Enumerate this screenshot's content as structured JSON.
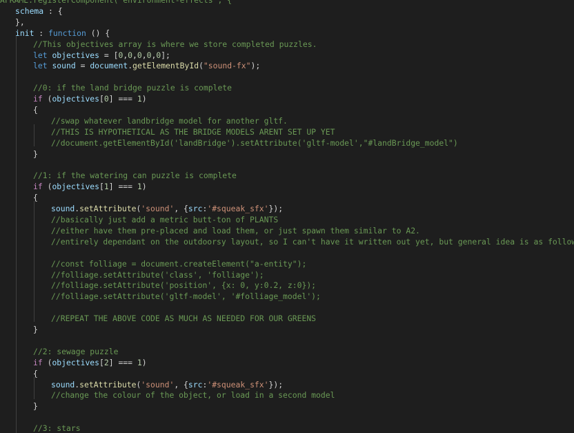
{
  "editor": {
    "language": "javascript",
    "theme_colors": {
      "background": "#1e1e1e",
      "default": "#d4d4d4",
      "keyword": "#569cd6",
      "control": "#c586c0",
      "function": "#dcdcaa",
      "variable": "#9cdcfe",
      "string": "#ce9178",
      "number": "#b5cea8",
      "comment": "#6a9955"
    },
    "lines": [
      {
        "tokens": [
          [
            "cmt",
            "AFRAME.registerComponent('environment-effects', {"
          ]
        ]
      },
      {
        "tokens": [
          [
            "var",
            "schema"
          ],
          [
            "pun",
            " : {"
          ]
        ]
      },
      {
        "tokens": [
          [
            "pun",
            "},"
          ]
        ]
      },
      {
        "tokens": [
          [
            "var",
            "init"
          ],
          [
            "pun",
            " : "
          ],
          [
            "kw",
            "function"
          ],
          [
            "pun",
            " () {"
          ]
        ]
      },
      {
        "tokens": [
          [
            "cmt",
            "//This objectives array is where we store completed puzzles."
          ]
        ]
      },
      {
        "tokens": [
          [
            "kw",
            "let"
          ],
          [
            "pun",
            " "
          ],
          [
            "var",
            "objectives"
          ],
          [
            "pun",
            " = ["
          ],
          [
            "num",
            "0"
          ],
          [
            "pun",
            ","
          ],
          [
            "num",
            "0"
          ],
          [
            "pun",
            ","
          ],
          [
            "num",
            "0"
          ],
          [
            "pun",
            ","
          ],
          [
            "num",
            "0"
          ],
          [
            "pun",
            ","
          ],
          [
            "num",
            "0"
          ],
          [
            "pun",
            "];"
          ]
        ]
      },
      {
        "tokens": [
          [
            "kw",
            "let"
          ],
          [
            "pun",
            " "
          ],
          [
            "var",
            "sound"
          ],
          [
            "pun",
            " = "
          ],
          [
            "var",
            "document"
          ],
          [
            "pun",
            "."
          ],
          [
            "fn",
            "getElementById"
          ],
          [
            "pun",
            "("
          ],
          [
            "str",
            "\"sound-fx\""
          ],
          [
            "pun",
            ");"
          ]
        ]
      },
      {
        "tokens": []
      },
      {
        "tokens": [
          [
            "cmt",
            "//0: if the land bridge puzzle is complete"
          ]
        ]
      },
      {
        "tokens": [
          [
            "ctl",
            "if"
          ],
          [
            "pun",
            " ("
          ],
          [
            "var",
            "objectives"
          ],
          [
            "pun",
            "["
          ],
          [
            "num",
            "0"
          ],
          [
            "pun",
            "] === "
          ],
          [
            "num",
            "1"
          ],
          [
            "pun",
            ")"
          ]
        ]
      },
      {
        "tokens": [
          [
            "pun",
            "{"
          ]
        ]
      },
      {
        "tokens": [
          [
            "cmt",
            "//swap whatever landbridge model for another gltf."
          ]
        ]
      },
      {
        "tokens": [
          [
            "cmt",
            "//THIS IS HYPOTHETICAL AS THE BRIDGE MODELS ARENT SET UP YET"
          ]
        ]
      },
      {
        "tokens": [
          [
            "cmt",
            "//document.getElementById('landBridge').setAttribute('gltf-model',\"#landBridge_model\")"
          ]
        ]
      },
      {
        "tokens": [
          [
            "pun",
            "}"
          ]
        ]
      },
      {
        "tokens": []
      },
      {
        "tokens": [
          [
            "cmt",
            "//1: if the watering can puzzle is complete"
          ]
        ]
      },
      {
        "tokens": [
          [
            "ctl",
            "if"
          ],
          [
            "pun",
            " ("
          ],
          [
            "var",
            "objectives"
          ],
          [
            "pun",
            "["
          ],
          [
            "num",
            "1"
          ],
          [
            "pun",
            "] === "
          ],
          [
            "num",
            "1"
          ],
          [
            "pun",
            ")"
          ]
        ]
      },
      {
        "tokens": [
          [
            "pun",
            "{"
          ]
        ]
      },
      {
        "tokens": [
          [
            "var",
            "sound"
          ],
          [
            "pun",
            "."
          ],
          [
            "fn",
            "setAttribute"
          ],
          [
            "pun",
            "("
          ],
          [
            "str",
            "'sound'"
          ],
          [
            "pun",
            ", {"
          ],
          [
            "var",
            "src"
          ],
          [
            "pun",
            ":"
          ],
          [
            "str",
            "'#squeak_sfx'"
          ],
          [
            "pun",
            "});"
          ]
        ]
      },
      {
        "tokens": [
          [
            "cmt",
            "//basically just add a metric butt-ton of PLANTS"
          ]
        ]
      },
      {
        "tokens": [
          [
            "cmt",
            "//either have them pre-placed and load them, or just spawn them similar to A2."
          ]
        ]
      },
      {
        "tokens": [
          [
            "cmt",
            "//entirely dependant on the outdoorsy layout, so I can't have it written out yet, but general idea is as follows:"
          ]
        ]
      },
      {
        "tokens": []
      },
      {
        "tokens": [
          [
            "cmt",
            "//const folliage = document.createElement(\"a-entity\");"
          ]
        ]
      },
      {
        "tokens": [
          [
            "cmt",
            "//folliage.setAttribute('class', 'folliage');"
          ]
        ]
      },
      {
        "tokens": [
          [
            "cmt",
            "//folliage.setAttribute('position', {x: 0, y:0.2, z:0});"
          ]
        ]
      },
      {
        "tokens": [
          [
            "cmt",
            "//folliage.setAttribute('gltf-model', '#folliage_model');"
          ]
        ]
      },
      {
        "tokens": []
      },
      {
        "tokens": [
          [
            "cmt",
            "//REPEAT THE ABOVE CODE AS MUCH AS NEEDED FOR OUR GREENS"
          ]
        ]
      },
      {
        "tokens": [
          [
            "pun",
            "}"
          ]
        ]
      },
      {
        "tokens": []
      },
      {
        "tokens": [
          [
            "cmt",
            "//2: sewage puzzle"
          ]
        ]
      },
      {
        "tokens": [
          [
            "ctl",
            "if"
          ],
          [
            "pun",
            " ("
          ],
          [
            "var",
            "objectives"
          ],
          [
            "pun",
            "["
          ],
          [
            "num",
            "2"
          ],
          [
            "pun",
            "] === "
          ],
          [
            "num",
            "1"
          ],
          [
            "pun",
            ")"
          ]
        ]
      },
      {
        "tokens": [
          [
            "pun",
            "{"
          ]
        ]
      },
      {
        "tokens": [
          [
            "var",
            "sound"
          ],
          [
            "pun",
            "."
          ],
          [
            "fn",
            "setAttribute"
          ],
          [
            "pun",
            "("
          ],
          [
            "str",
            "'sound'"
          ],
          [
            "pun",
            ", {"
          ],
          [
            "var",
            "src"
          ],
          [
            "pun",
            ":"
          ],
          [
            "str",
            "'#squeak_sfx'"
          ],
          [
            "pun",
            "});"
          ]
        ]
      },
      {
        "tokens": [
          [
            "cmt",
            "//change the colour of the object, or load in a second model"
          ]
        ]
      },
      {
        "tokens": [
          [
            "pun",
            "}"
          ]
        ]
      },
      {
        "tokens": []
      },
      {
        "tokens": [
          [
            "cmt",
            "//3: stars"
          ]
        ]
      }
    ]
  }
}
